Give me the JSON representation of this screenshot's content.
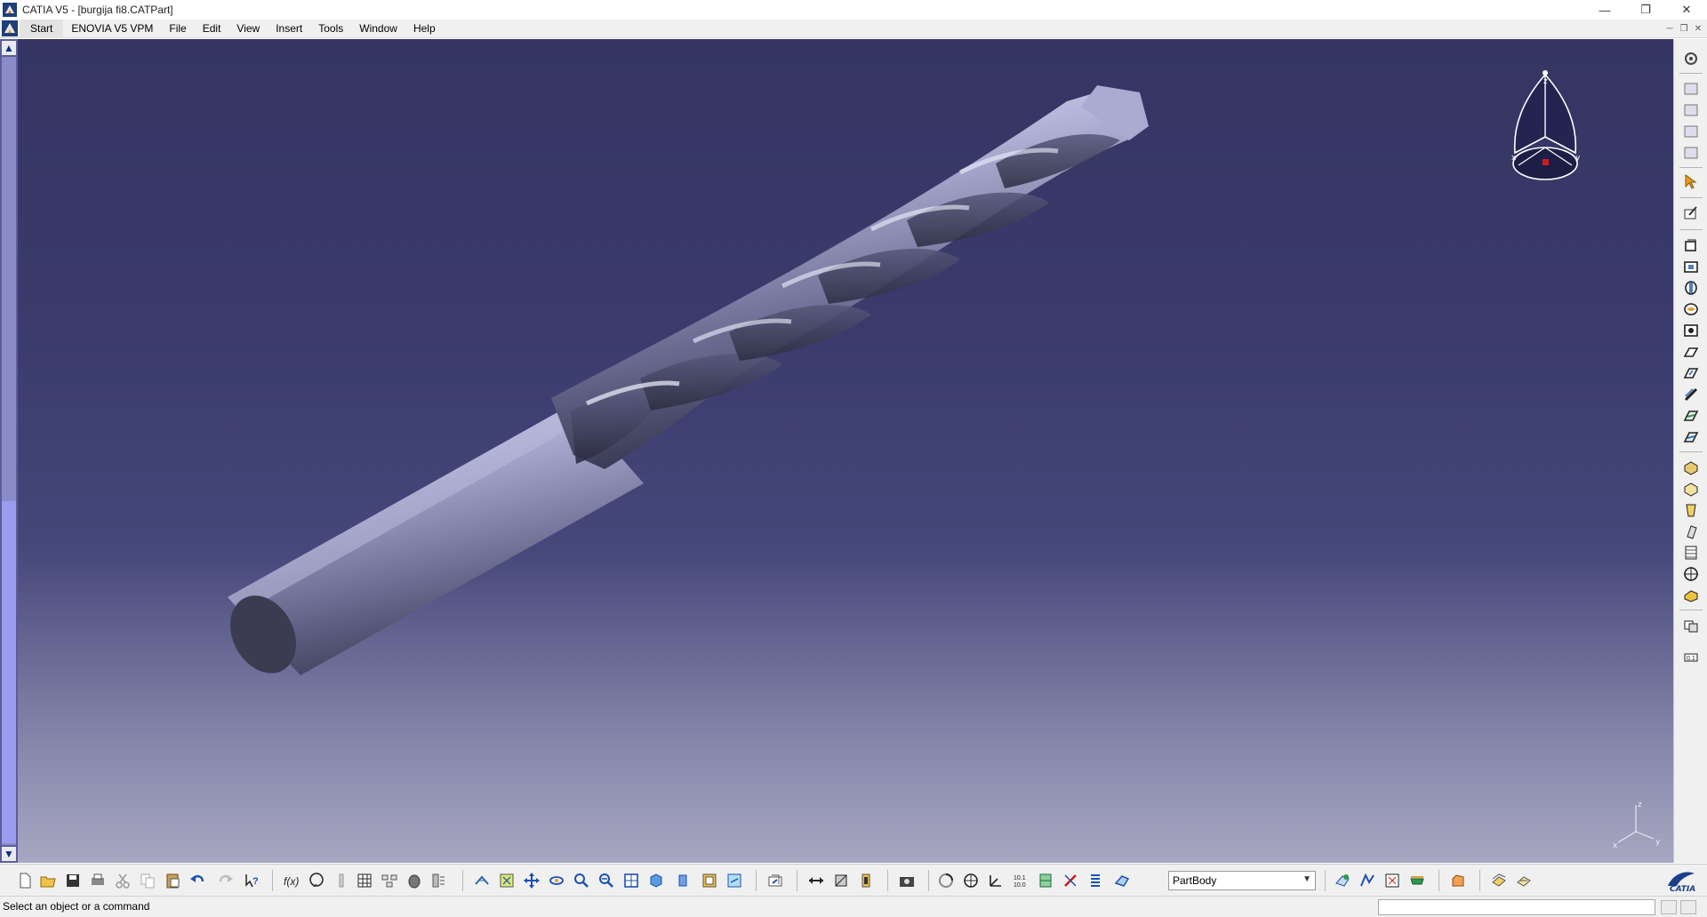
{
  "window": {
    "title": "CATIA V5 - [burgija fi8.CATPart]",
    "minimize": "—",
    "maximize": "❐",
    "close": "✕"
  },
  "menu": {
    "items": [
      "Start",
      "ENOVIA V5 VPM",
      "File",
      "Edit",
      "View",
      "Insert",
      "Tools",
      "Window",
      "Help"
    ]
  },
  "viewport": {
    "compass_labels": {
      "z": "z",
      "x": "x",
      "y": "y"
    },
    "axis_labels": {
      "z": "z",
      "x": "x",
      "y": "y"
    }
  },
  "toolbar": {
    "work_object": "PartBody"
  },
  "status": {
    "message": "Select an object or a command",
    "command_value": ""
  },
  "colors": {
    "viewport_top": "#343562",
    "viewport_bottom": "#a7a7c2",
    "part_light": "#c9cbe6",
    "part_dark": "#3d3e55"
  }
}
